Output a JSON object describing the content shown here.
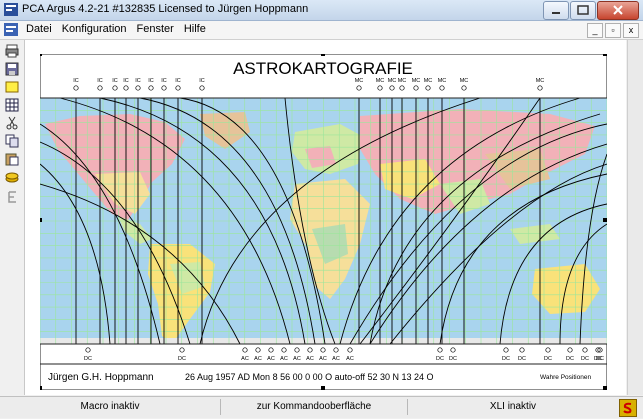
{
  "window": {
    "title": "PCA Argus 4.2-21  #132835   Licensed to  Jürgen Hoppmann"
  },
  "menu": {
    "items": [
      "Datei",
      "Konfiguration",
      "Fenster",
      "Hilfe"
    ]
  },
  "mdi": {
    "minimize": "_",
    "restore": "▫",
    "close": "x"
  },
  "chart": {
    "title": "ASTROKARTOGRAFIE",
    "footer_name": "Jürgen G.H. Hoppmann",
    "footer_data": "26 Aug 1957 AD Mon    8 56 00    0 00 O auto-off  52 30 N  13 24 O",
    "footer_note": "Wahre Positionen",
    "top_labels": [
      "IC",
      "IC",
      "IC",
      "IC",
      "IC",
      "IC",
      "IC",
      "IC",
      "IC",
      "MC",
      "MC",
      "MC",
      "MC",
      "MC",
      "MC",
      "MC",
      "MC",
      "MC"
    ],
    "bottom_labels": [
      "DC",
      "DC",
      "AC",
      "AC",
      "AC",
      "AC",
      "AC",
      "AC",
      "AC",
      "AC",
      "AC",
      "DC",
      "DC",
      "DC",
      "DC",
      "DC",
      "DC",
      "DC",
      "DC",
      "DC"
    ]
  },
  "status": {
    "macro": "Macro inaktiv",
    "command": "zur Kommandooberfläche",
    "xli": "XLI inaktiv"
  },
  "colors": {
    "ocean": "#a9d4ee",
    "grid": "#9be69b",
    "land": [
      "#f6df9a",
      "#f2b1b8",
      "#cfe9a5",
      "#f9e27a",
      "#e6c39a",
      "#b7dcb0"
    ]
  }
}
